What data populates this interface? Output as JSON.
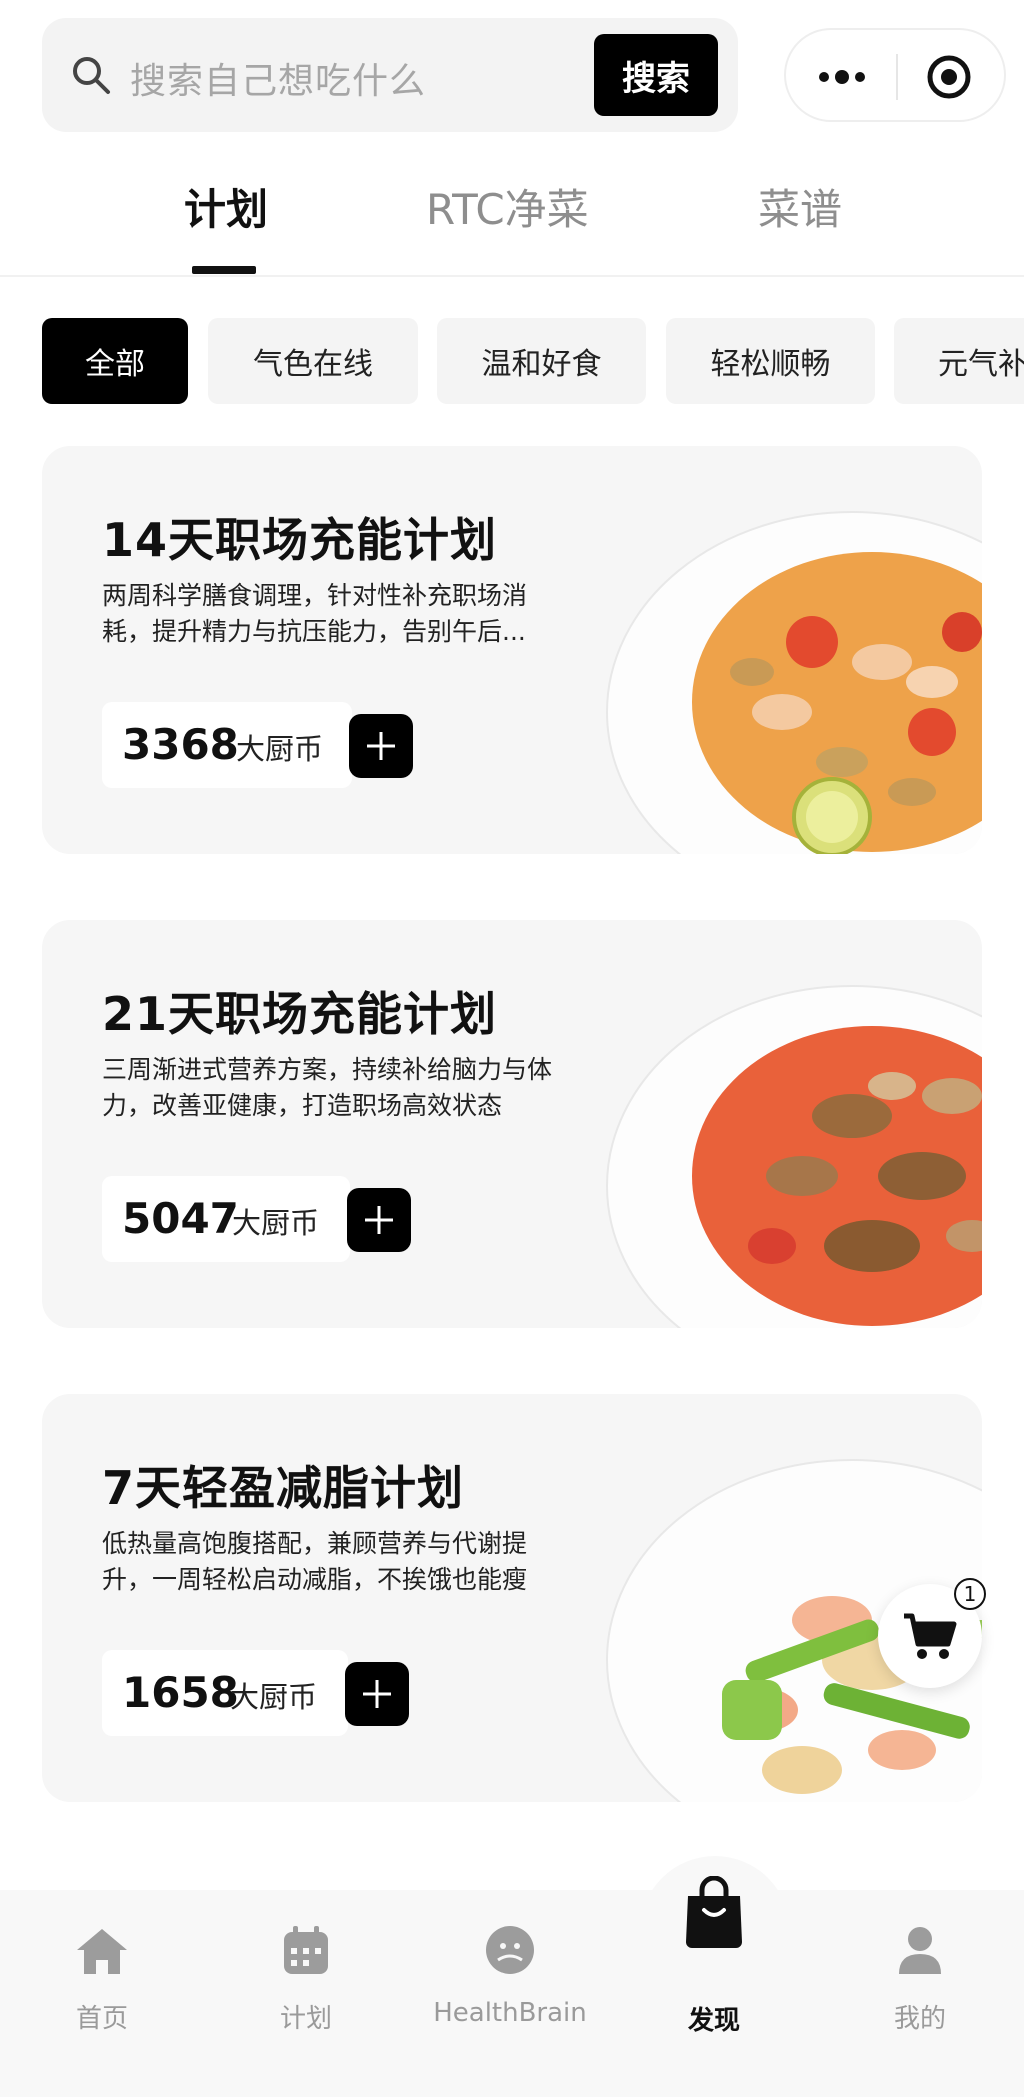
{
  "search": {
    "placeholder": "搜索自己想吃什么",
    "button": "搜索"
  },
  "tabs": [
    {
      "label": "计划",
      "active": true
    },
    {
      "label": "RTC净菜",
      "active": false
    },
    {
      "label": "菜谱",
      "active": false
    }
  ],
  "chips": [
    {
      "label": "全部",
      "active": true
    },
    {
      "label": "气色在线",
      "active": false
    },
    {
      "label": "温和好食",
      "active": false
    },
    {
      "label": "轻松顺畅",
      "active": false
    },
    {
      "label": "元气补",
      "active": false
    }
  ],
  "plans": [
    {
      "title": "14天职场充能计划",
      "desc": "两周科学膳食调理，针对性补充职场消耗，提升精力与抗压能力，告别午后...",
      "price": "3368",
      "unit": "大厨币",
      "dish_icon": "shrimp-tomato-soup-image"
    },
    {
      "title": "21天职场充能计划",
      "desc": "三周渐进式营养方案，持续补给脑力与体力，改善亚健康，打造职场高效状态",
      "price": "5047",
      "unit": "大厨币",
      "dish_icon": "beef-mushroom-stew-image"
    },
    {
      "title": "7天轻盈减脂计划",
      "desc": "低热量高饱腹搭配，兼顾营养与代谢提升，一周轻松启动减脂，不挨饿也能瘦",
      "price": "1658",
      "unit": "大厨币",
      "dish_icon": "shrimp-asparagus-stirfry-image"
    }
  ],
  "cart": {
    "count": "1"
  },
  "bottom_nav": [
    {
      "label": "首页",
      "icon": "home-icon",
      "active": false
    },
    {
      "label": "计划",
      "icon": "calendar-icon",
      "active": false
    },
    {
      "label": "HealthBrain",
      "icon": "brain-icon",
      "active": false
    },
    {
      "label": "发现",
      "icon": "shopping-bag-icon",
      "active": true
    },
    {
      "label": "我的",
      "icon": "person-icon",
      "active": false
    }
  ],
  "colors": {
    "accent": "#000000",
    "card_bg": "#f6f6f6",
    "inactive": "#9a9a9a"
  }
}
